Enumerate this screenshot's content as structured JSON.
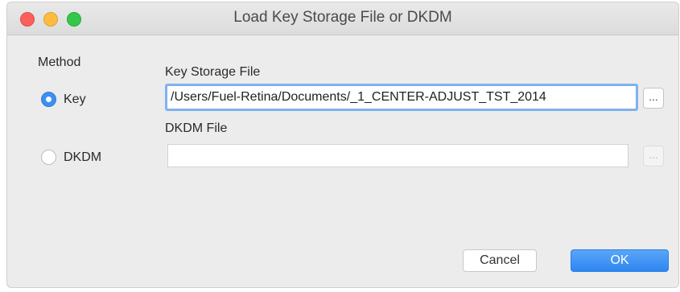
{
  "window": {
    "title": "Load Key Storage File or DKDM"
  },
  "method": {
    "label": "Method",
    "options": [
      {
        "label": "Key",
        "checked": true
      },
      {
        "label": "DKDM",
        "checked": false
      }
    ]
  },
  "key_storage": {
    "label": "Key Storage File",
    "value": "/Users/Fuel-Retina/Documents/_1_CENTER-ADJUST_TST_2014",
    "browse_label": "..."
  },
  "dkdm": {
    "label": "DKDM File",
    "value": "",
    "browse_label": "..."
  },
  "buttons": {
    "cancel": "Cancel",
    "ok": "OK"
  }
}
